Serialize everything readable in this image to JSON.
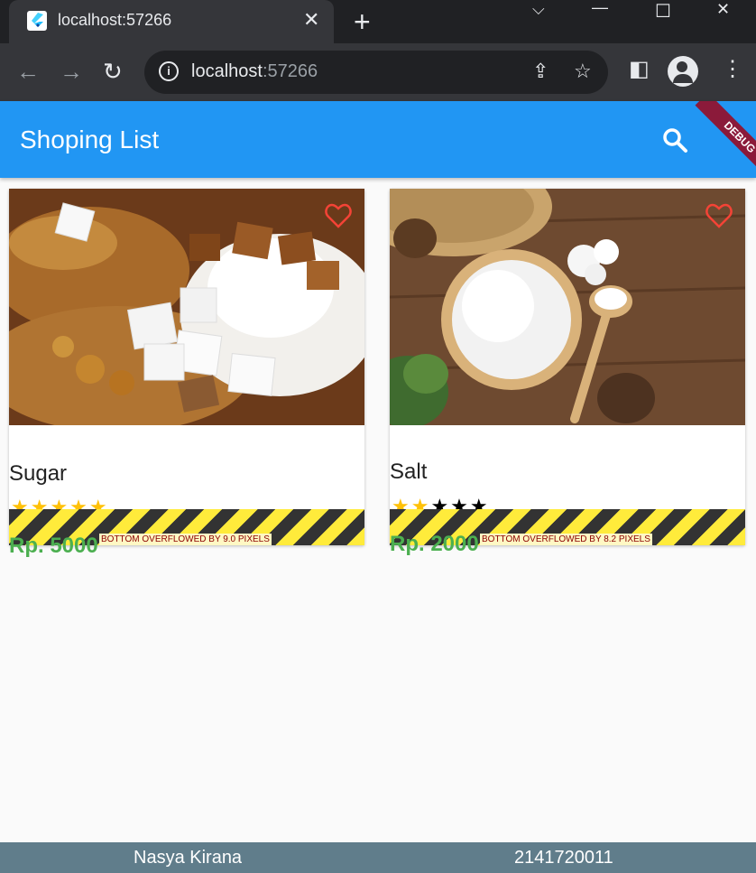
{
  "browser": {
    "tab_title": "localhost:57266",
    "url_host": "localhost",
    "url_port": ":57266"
  },
  "app": {
    "title": "Shoping List",
    "debug_label": "DEBUG",
    "accent": "#2196f3"
  },
  "products": [
    {
      "name": "Sugar",
      "rating": 5,
      "max_rating": 5,
      "price": "Rp. 5000",
      "overflow_text": "BOTTOM OVERFLOWED BY 9.0 PIXELS",
      "stars_on": "★★★★★",
      "stars_off": ""
    },
    {
      "name": "Salt",
      "rating": 2,
      "max_rating": 5,
      "price": "Rp. 2000",
      "overflow_text": "BOTTOM OVERFLOWED BY 8.2 PIXELS",
      "stars_on": "★★",
      "stars_off": "★★★"
    }
  ],
  "footer": {
    "name": "Nasya Kirana",
    "nim": "2141720011"
  }
}
